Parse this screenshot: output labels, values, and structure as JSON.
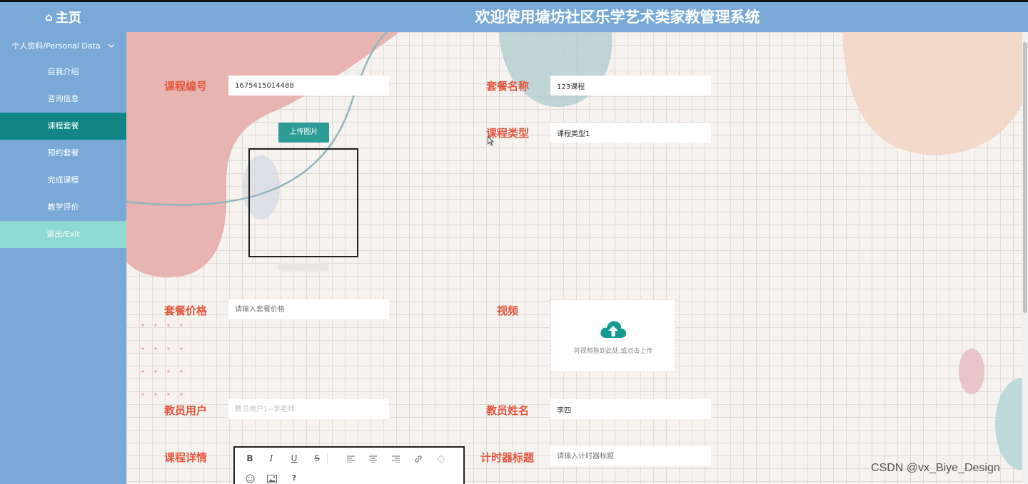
{
  "header": {
    "home_icon": "home-icon",
    "home_label": "主页",
    "title": "欢迎使用塘坊社区乐学艺术类家教管理系统"
  },
  "sidebar": {
    "group_label": "个人资料/Personal Data",
    "group_icon": "chevron-down-icon",
    "items": [
      {
        "label": "自我介绍"
      },
      {
        "label": "咨询信息"
      },
      {
        "label": "课程套餐"
      },
      {
        "label": "预约套餐"
      },
      {
        "label": "完成课程"
      },
      {
        "label": "教学评价"
      },
      {
        "label": "退出/Exit"
      }
    ],
    "active_index": 2
  },
  "form": {
    "course_no": {
      "label": "课程编号",
      "value": "1675415014488"
    },
    "package_name": {
      "label": "套餐名称",
      "value": "123课程"
    },
    "upload_image": {
      "button": "上传图片"
    },
    "course_type": {
      "label": "课程类型",
      "value": "课程类型1"
    },
    "package_price": {
      "label": "套餐价格",
      "placeholder": "请输入套餐价格"
    },
    "video": {
      "label": "视频",
      "hint": "将视频拖到此处,或点击上传",
      "icon": "cloud-upload-icon"
    },
    "teacher_user": {
      "label": "教员用户",
      "placeholder": "教员用户1--李老师"
    },
    "teacher_name": {
      "label": "教员姓名",
      "value": "李四"
    },
    "course_detail": {
      "label": "课程详情"
    },
    "timer_title": {
      "label": "计时器标题",
      "placeholder": "请输入计时器标题"
    }
  },
  "editor_toolbar": {
    "bold": "B",
    "italic": "I",
    "underline": "U",
    "strike": "S",
    "help": "?",
    "icons": [
      "align-left-icon",
      "align-center-icon",
      "align-right-icon",
      "link-icon",
      "unlink-icon",
      "emoji-icon",
      "image-icon"
    ]
  },
  "watermark": "CSDN @vx_Biye_Design",
  "colors": {
    "header_bg": "#7aa9d8",
    "active_menu": "#128687",
    "exit_menu": "#8fd9d3",
    "label": "#e2573f",
    "upload_button": "#2e9c96"
  }
}
